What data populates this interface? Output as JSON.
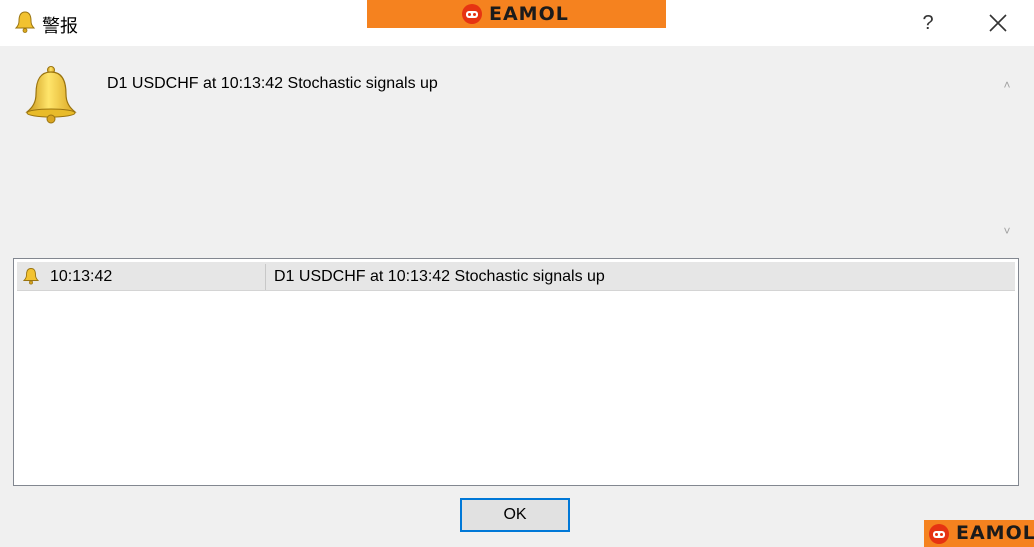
{
  "window": {
    "title": "警报",
    "help_label": "?",
    "icons": {
      "title": "bell-icon",
      "help": "question-icon",
      "close": "close-icon"
    }
  },
  "watermark": {
    "text": "EAMOL",
    "logo_icon": "eamol-logo-icon",
    "background": "#f5821f"
  },
  "alert": {
    "message": "D1 USDCHF at 10:13:42 Stochastic signals up",
    "icon": "bell-icon",
    "scroll_up": "˄",
    "scroll_down": "˅"
  },
  "list": {
    "rows": [
      {
        "time": "10:13:42",
        "message": "D1 USDCHF at 10:13:42 Stochastic signals up",
        "icon": "bell-icon"
      }
    ]
  },
  "buttons": {
    "ok_label": "OK"
  },
  "colors": {
    "accent": "#0078d7",
    "bell": "#f2c230"
  }
}
